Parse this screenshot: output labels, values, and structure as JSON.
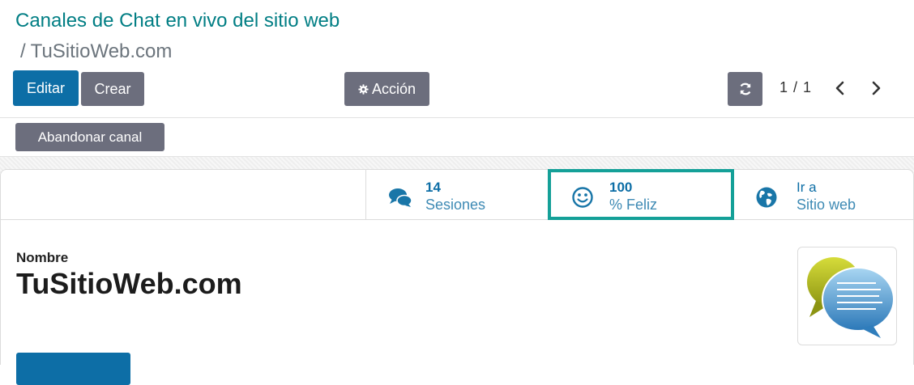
{
  "breadcrumb": {
    "parent": "Canales de Chat en vivo del sitio web",
    "separator": "/",
    "current": "TuSitioWeb.com"
  },
  "toolbar": {
    "edit_label": "Editar",
    "create_label": "Crear",
    "action_label": "Acción",
    "action_icon": "gear-icon",
    "refresh_icon": "refresh-icon",
    "pager_text": "1 / 1"
  },
  "header_buttons": {
    "leave_channel_label": "Abandonar canal"
  },
  "stats": {
    "sessions": {
      "value": "14",
      "label": "Sesiones",
      "icon": "comments-icon"
    },
    "happy": {
      "value": "100",
      "label": "% Feliz",
      "icon": "smiley-icon"
    },
    "website": {
      "value": "Ir a",
      "label": "Sitio web",
      "icon": "globe-icon"
    }
  },
  "form": {
    "name_label": "Nombre",
    "name_value": "TuSitioWeb.com"
  },
  "colors": {
    "primary": "#0d6ea6",
    "secondary": "#6c6e7d",
    "link": "#017e84",
    "highlight": "#14a098"
  }
}
